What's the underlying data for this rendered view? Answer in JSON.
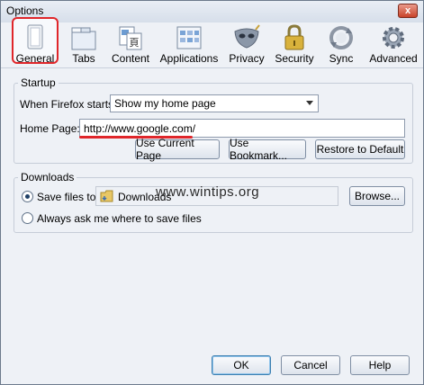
{
  "window": {
    "title": "Options",
    "close_glyph": "x"
  },
  "toolbar": {
    "tabs": [
      {
        "label": "General",
        "icon": "general-icon",
        "selected": true
      },
      {
        "label": "Tabs",
        "icon": "tabs-icon"
      },
      {
        "label": "Content",
        "icon": "content-icon"
      },
      {
        "label": "Applications",
        "icon": "applications-icon"
      },
      {
        "label": "Privacy",
        "icon": "privacy-mask-icon"
      },
      {
        "label": "Security",
        "icon": "padlock-icon"
      },
      {
        "label": "Sync",
        "icon": "sync-icon"
      },
      {
        "label": "Advanced",
        "icon": "gear-icon"
      }
    ]
  },
  "startup": {
    "group_label": "Startup",
    "when_starts_label": "When Firefox starts:",
    "when_starts_value": "Show my home page",
    "home_page_label": "Home Page:",
    "home_page_value": "http://www.google.com/",
    "use_current_label": "Use Current Page",
    "use_bookmark_label": "Use Bookmark...",
    "restore_default_label": "Restore to Default"
  },
  "downloads": {
    "group_label": "Downloads",
    "save_files_label": "Save files to",
    "save_folder": "Downloads",
    "browse_label": "Browse...",
    "always_ask_label": "Always ask me where to save files",
    "save_files_selected": true
  },
  "watermark": "www.wintips.org",
  "footer": {
    "ok_label": "OK",
    "cancel_label": "Cancel",
    "help_label": "Help"
  },
  "colors": {
    "highlight": "#e0262a",
    "window_bg": "#eef1f6"
  }
}
